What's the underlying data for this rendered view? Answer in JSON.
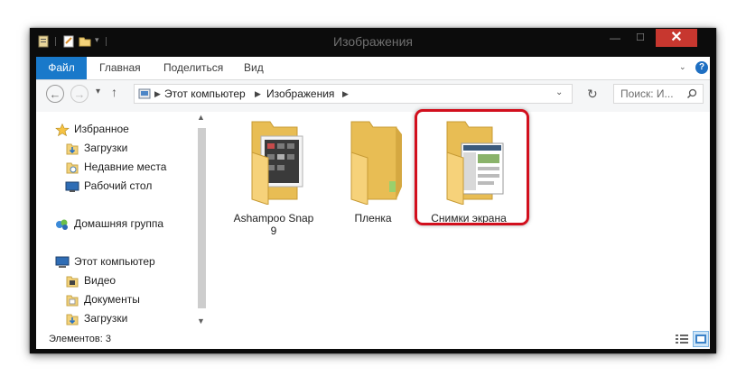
{
  "window": {
    "title": "Изображения"
  },
  "titlebar": {
    "minimize": "—",
    "maximize": "☐",
    "close": "✕"
  },
  "ribbon": {
    "tabs": [
      "Файл",
      "Главная",
      "Поделиться",
      "Вид"
    ]
  },
  "navigation": {
    "back": "←",
    "forward": "→",
    "dropdown": "▾",
    "up": "↑"
  },
  "address": {
    "crumbs": [
      "Этот компьютер",
      "Изображения"
    ],
    "refresh": "↻"
  },
  "search": {
    "placeholder": "Поиск: И..."
  },
  "sidebar": {
    "items": [
      {
        "label": "Избранное",
        "icon": "star-icon"
      },
      {
        "label": "Загрузки",
        "icon": "downloads-folder-icon"
      },
      {
        "label": "Недавние места",
        "icon": "recent-places-icon"
      },
      {
        "label": "Рабочий стол",
        "icon": "desktop-icon"
      },
      {
        "label": "Домашняя группа",
        "icon": "homegroup-icon"
      },
      {
        "label": "Этот компьютер",
        "icon": "computer-icon"
      },
      {
        "label": "Видео",
        "icon": "video-folder-icon"
      },
      {
        "label": "Документы",
        "icon": "documents-folder-icon"
      },
      {
        "label": "Загрузки",
        "icon": "downloads-folder-icon"
      }
    ]
  },
  "files": [
    {
      "label_line1": "Ashampoo Snap",
      "label_line2": "9",
      "icon": "folder-icon"
    },
    {
      "label_line1": "Пленка",
      "label_line2": "",
      "icon": "folder-icon"
    },
    {
      "label_line1": "Снимки экрана",
      "label_line2": "",
      "icon": "folder-icon",
      "highlighted": true
    }
  ],
  "status": {
    "text": "Элементов: 3"
  },
  "colors": {
    "file_tab": "#1979ca",
    "close_button": "#c7372f",
    "highlight": "#d20f1d",
    "folder": "#f3d27a"
  }
}
